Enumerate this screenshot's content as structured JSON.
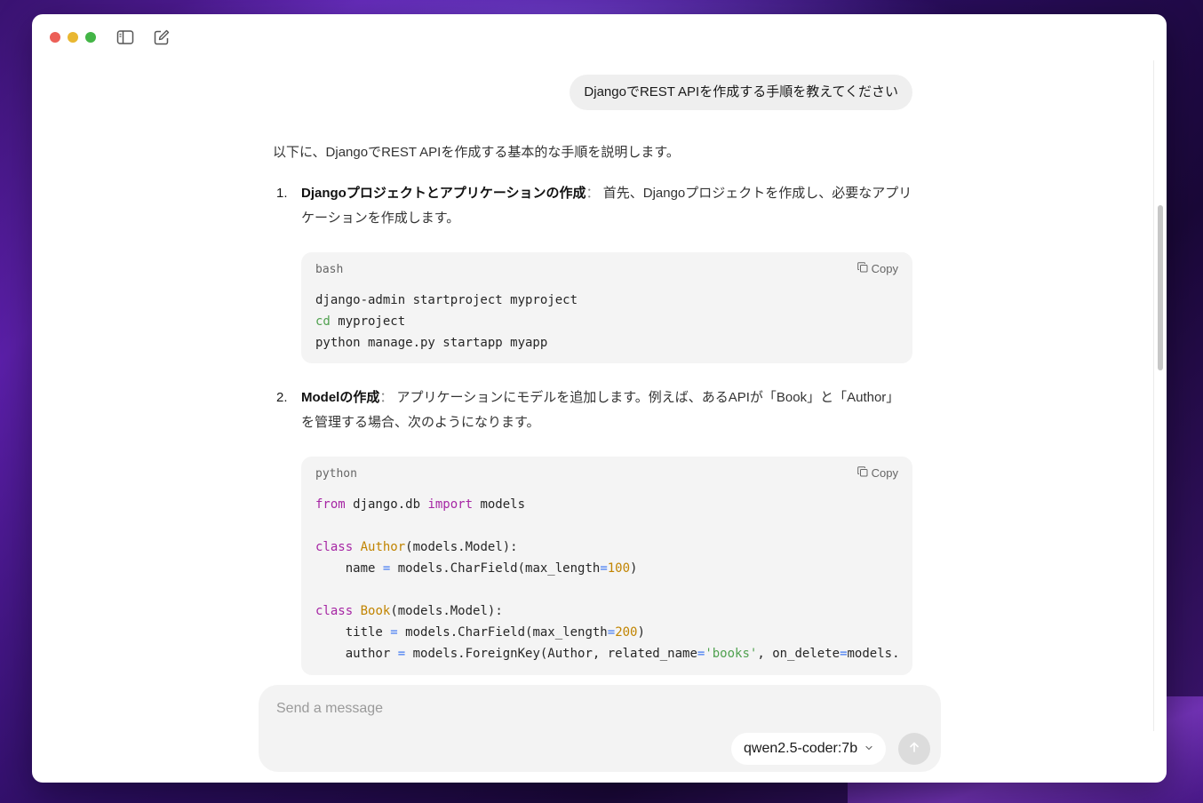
{
  "chat": {
    "user_message": "DjangoでREST APIを作成する手順を教えてください",
    "intro": "以下に、DjangoでREST APIを作成する基本的な手順を説明します。",
    "steps": [
      {
        "num": "1.",
        "title": "Djangoプロジェクトとアプリケーションの作成",
        "separator": "：",
        "text": " 首先、Djangoプロジェクトを作成し、必要なアプリケーションを作成します。",
        "code": {
          "lang": "bash",
          "copy_label": "Copy",
          "lines": [
            "django-admin startproject myproject",
            "cd myproject",
            "python manage.py startapp myapp"
          ]
        }
      },
      {
        "num": "2.",
        "title": "Modelの作成",
        "separator": "：",
        "text": " アプリケーションにモデルを追加します。例えば、あるAPIが「Book」と「Author」を管理する場合、次のようになります。",
        "code": {
          "lang": "python",
          "copy_label": "Copy",
          "lines": [
            "from django.db import models",
            "",
            "class Author(models.Model):",
            "    name = models.CharField(max_length=100)",
            "",
            "class Book(models.Model):",
            "    title = models.CharField(max_length=200)",
            "    author = models.ForeignKey(Author, related_name='books', on_delete=models."
          ]
        }
      }
    ]
  },
  "composer": {
    "placeholder": "Send a message",
    "model": "qwen2.5-coder:7b"
  },
  "icons": {
    "sidebar": "sidebar-toggle-icon",
    "compose": "new-chat-icon",
    "copy": "copy-icon",
    "chevron": "chevron-down-icon",
    "send": "arrow-up-icon"
  },
  "colors": {
    "keyword": "#a626a4",
    "class_name": "#c18401",
    "number": "#c18401",
    "operator": "#4078f2",
    "string": "#50a14f"
  }
}
